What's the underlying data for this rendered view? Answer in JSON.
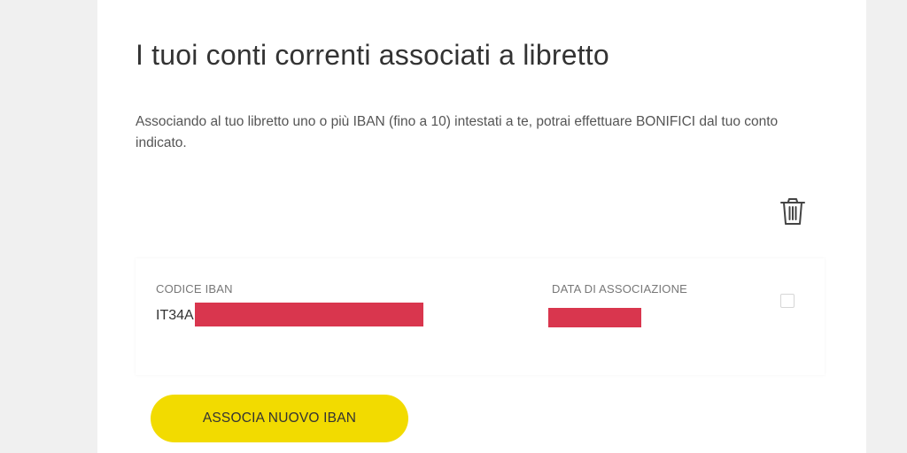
{
  "section": {
    "title": "I tuoi conti correnti associati a libretto",
    "description": "Associando al tuo libretto uno o più IBAN (fino a 10) intestati a te, potrai effettuare BONIFICI dal tuo conto indicato."
  },
  "actions": {
    "delete_icon": "trash-icon"
  },
  "iban_table": {
    "columns": [
      "CODICE IBAN",
      "DATA DI ASSOCIAZIONE"
    ],
    "rows": [
      {
        "iban_visible_prefix": "IT34A",
        "iban_redacted": true,
        "date_redacted": true,
        "selected": false
      }
    ]
  },
  "buttons": {
    "associate_new_iban": "ASSOCIA NUOVO IBAN"
  },
  "colors": {
    "accent_yellow": "#f2db00",
    "redaction": "#d9364e",
    "text_dark": "#333333",
    "background": "#f0f0f0"
  }
}
